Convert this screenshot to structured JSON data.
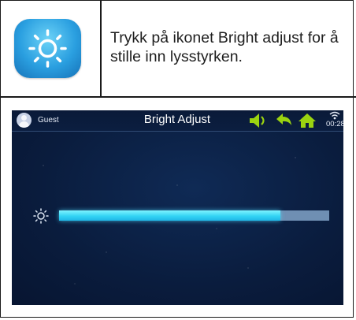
{
  "instruction": {
    "text": "Trykk på ikonet Bright adjust for å stille inn lysstyrken.",
    "icon": "brightness-icon"
  },
  "device": {
    "user": "Guest",
    "title": "Bright Adjust",
    "time": "00:28",
    "status_icons": [
      "volume-icon",
      "back-icon",
      "home-icon",
      "wifi-icon"
    ],
    "brightness": {
      "icon": "brightness-icon",
      "level_percent": 82
    },
    "colors": {
      "accent": "#33d4f4",
      "status_icons": "#9bd310",
      "background": "#0a1c3d"
    }
  }
}
